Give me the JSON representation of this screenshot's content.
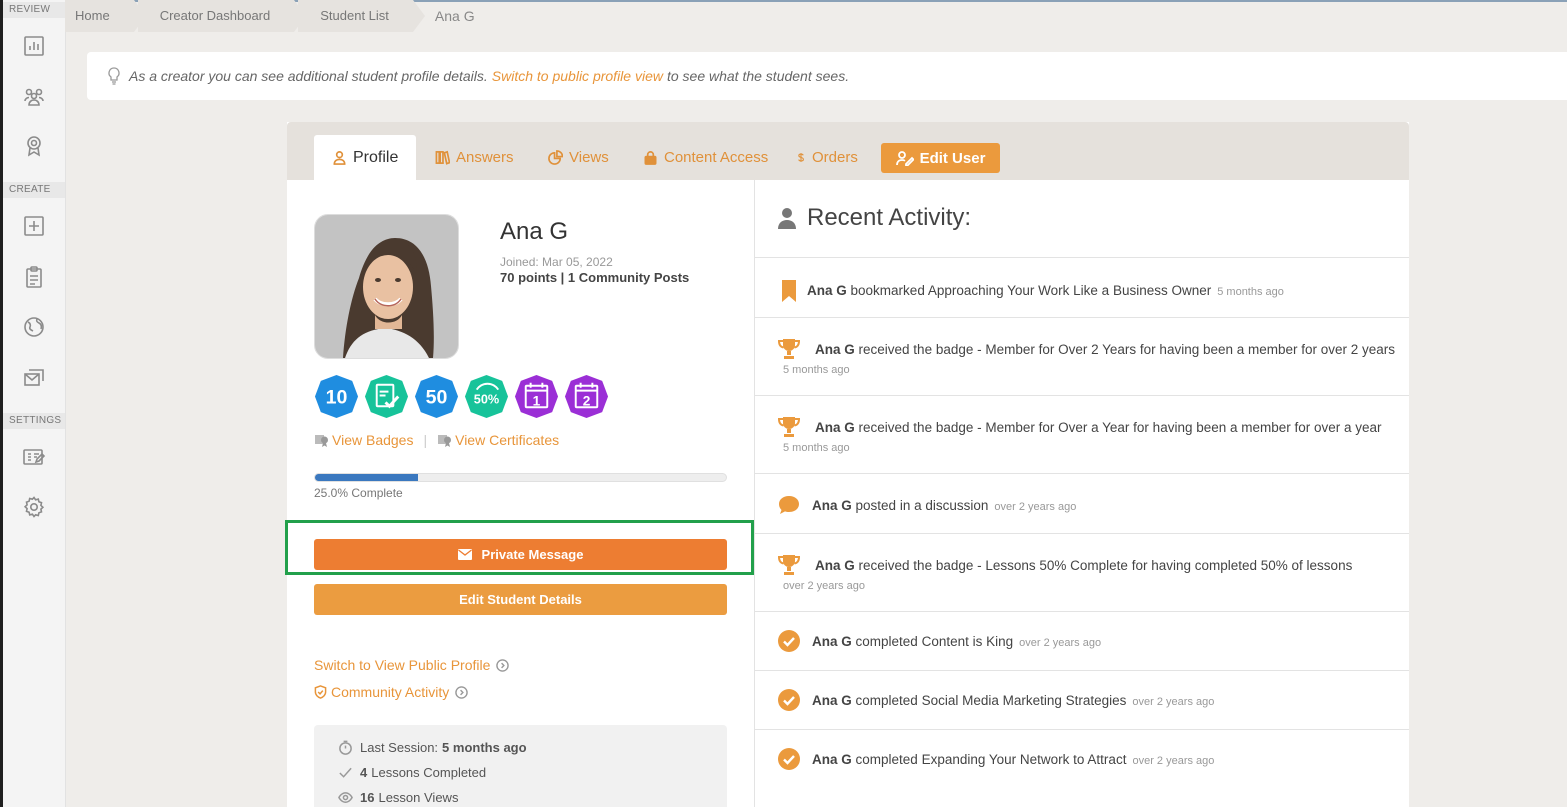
{
  "sidebar": {
    "sections": [
      {
        "label": "REVIEW",
        "items": [
          {
            "icon": "bar-chart-icon"
          },
          {
            "icon": "users-icon"
          },
          {
            "icon": "award-icon"
          }
        ]
      },
      {
        "label": "CREATE",
        "items": [
          {
            "icon": "plus-square-icon"
          },
          {
            "icon": "clipboard-icon"
          },
          {
            "icon": "globe-icon"
          },
          {
            "icon": "mail-stack-icon"
          }
        ]
      },
      {
        "label": "SETTINGS",
        "items": [
          {
            "icon": "pricing-icon"
          },
          {
            "icon": "gear-icon"
          }
        ]
      }
    ]
  },
  "breadcrumb": [
    "Home",
    "Creator Dashboard",
    "Student List",
    "Ana G"
  ],
  "info": {
    "before": "As a creator you can see additional student profile details.",
    "link": "Switch to public profile view",
    "after": "to see what the student sees."
  },
  "tabs": [
    {
      "label": "Profile",
      "icon": "user-icon",
      "active": true
    },
    {
      "label": "Answers",
      "icon": "books-icon"
    },
    {
      "label": "Views",
      "icon": "pie-chart-icon"
    },
    {
      "label": "Content Access",
      "icon": "lock-icon"
    },
    {
      "label": "Orders",
      "icon": "dollar-icon"
    }
  ],
  "edit_user_label": "Edit User",
  "profile": {
    "name": "Ana G",
    "joined": "Joined: Mar 05, 2022",
    "points": "70 points | 1 Community Posts",
    "badges": [
      {
        "label": "10",
        "color": "#1f8de0"
      },
      {
        "label": "",
        "icon": "checklist-icon",
        "color": "#17c39a"
      },
      {
        "label": "50",
        "color": "#1f8de0"
      },
      {
        "label": "50%",
        "color": "#17c39a"
      },
      {
        "label": "1",
        "icon": "calendar-icon",
        "color": "#9b2fd6"
      },
      {
        "label": "2",
        "icon": "calendar-icon",
        "color": "#9b2fd6"
      }
    ],
    "view_badges": "View Badges",
    "view_certificates": "View Certificates",
    "progress": 0.25,
    "progress_label": "25.0% Complete",
    "private_message": "Private Message",
    "edit_student": "Edit Student Details",
    "switch_public": "Switch to View Public Profile",
    "community_activity": "Community Activity",
    "stats": [
      {
        "icon": "stopwatch-icon",
        "label": "Last Session:",
        "value": "5 months ago"
      },
      {
        "icon": "check-icon",
        "value": "4",
        "label": "Lessons Completed"
      },
      {
        "icon": "eye-icon",
        "value": "16",
        "label": "Lesson Views"
      }
    ]
  },
  "activity": {
    "title": "Recent Activity:",
    "items": [
      {
        "icon": "bookmark-icon",
        "user": "Ana G",
        "text": "bookmarked Approaching Your Work Like a Business Owner",
        "when": "5 months ago",
        "inline": true
      },
      {
        "icon": "trophy-icon",
        "user": "Ana G",
        "text": "received the badge - Member for Over 2 Years for having been a member for over 2 years",
        "when": "5 months ago",
        "inline": false
      },
      {
        "icon": "trophy-icon",
        "user": "Ana G",
        "text": "received the badge - Member for Over a Year for having been a member for over a year",
        "when": "5 months ago",
        "inline": false
      },
      {
        "icon": "chat-icon",
        "user": "Ana G",
        "text": "posted in a discussion",
        "when": "over 2 years ago",
        "inline": true
      },
      {
        "icon": "trophy-icon",
        "user": "Ana G",
        "text": "received the badge - Lessons 50% Complete for having completed 50% of lessons",
        "when": "over 2 years ago",
        "inline": false
      },
      {
        "icon": "check-circle-icon",
        "user": "Ana G",
        "text": "completed Content is King",
        "when": "over 2 years ago",
        "inline": true
      },
      {
        "icon": "check-circle-icon",
        "user": "Ana G",
        "text": "completed Social Media Marketing Strategies",
        "when": "over 2 years ago",
        "inline": true
      },
      {
        "icon": "check-circle-icon",
        "user": "Ana G",
        "text": "completed Expanding Your Network to Attract",
        "when": "over 2 years ago",
        "inline": true
      }
    ]
  },
  "colors": {
    "accent": "#e8953a",
    "message_button": "#ed7d32",
    "highlight": "#22a04b",
    "progress": "#3a78bf"
  }
}
